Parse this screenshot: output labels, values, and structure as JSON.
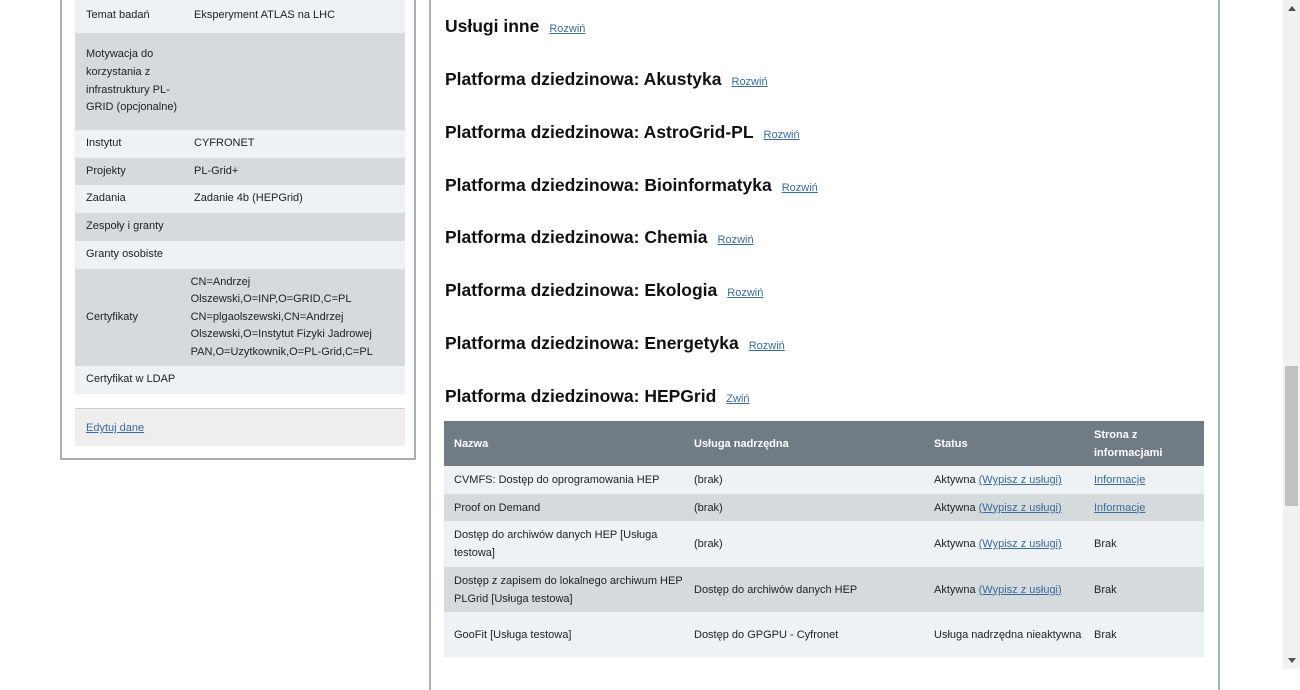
{
  "profile": {
    "rows": [
      {
        "key": "Temat badań",
        "value": "Eksperyment ATLAS na LHC"
      },
      {
        "key": "Motywacja do korzystania z infrastruktury PL-GRID (opcjonalne)",
        "value": ""
      },
      {
        "key": "Instytut",
        "value": "CYFRONET"
      },
      {
        "key": "Projekty",
        "value": "PL-Grid+"
      },
      {
        "key": "Zadania",
        "value": "Zadanie 4b (HEPGrid)"
      },
      {
        "key": "Zespoły i granty",
        "value": ""
      },
      {
        "key": "Granty osobiste",
        "value": ""
      },
      {
        "key": "Certyfikaty",
        "value": "CN=Andrzej Olszewski,O=INP,O=GRID,C=PL CN=plgaolszewski,CN=Andrzej Olszewski,O=Instytut Fizyki Jadrowej PAN,O=Uzytkownik,O=PL-Grid,C=PL"
      },
      {
        "key": "Certyfikat w LDAP",
        "value": ""
      }
    ],
    "edit_label": "Edytuj dane"
  },
  "sections": [
    {
      "title": "Usługi inne",
      "link": "Rozwiń"
    },
    {
      "title": "Platforma dziedzinowa: Akustyka",
      "link": "Rozwiń"
    },
    {
      "title": "Platforma dziedzinowa: AstroGrid-PL",
      "link": "Rozwiń"
    },
    {
      "title": "Platforma dziedzinowa: Bioinformatyka",
      "link": "Rozwiń"
    },
    {
      "title": "Platforma dziedzinowa: Chemia",
      "link": "Rozwiń"
    },
    {
      "title": "Platforma dziedzinowa: Ekologia",
      "link": "Rozwiń"
    },
    {
      "title": "Platforma dziedzinowa: Energetyka",
      "link": "Rozwiń"
    },
    {
      "title": "Platforma dziedzinowa: HEPGrid",
      "link": "Zwiń"
    }
  ],
  "services_table": {
    "headers": [
      "Nazwa",
      "Usługa nadrzędna",
      "Status",
      "Strona z informacjami"
    ],
    "rows": [
      {
        "name": "CVMFS: Dostęp do oprogramowania HEP",
        "parent": "(brak)",
        "status": "Aktywna",
        "action": "(Wypisz z usługi)",
        "info": "Informacje",
        "info_link": true
      },
      {
        "name": "Proof on Demand",
        "parent": "(brak)",
        "status": "Aktywna",
        "action": "(Wypisz z usługi)",
        "info": "Informacje",
        "info_link": true
      },
      {
        "name": "Dostęp do archiwów danych HEP [Usługa testowa]",
        "parent": "(brak)",
        "status": "Aktywna",
        "action": "(Wypisz z usługi)",
        "info": "Brak",
        "info_link": false
      },
      {
        "name": "Dostęp z zapisem do lokalnego archiwum HEP PLGrid [Usługa testowa]",
        "parent": "Dostęp do archiwów danych HEP",
        "status": "Aktywna",
        "action": "(Wypisz z usługi)",
        "info": "Brak",
        "info_link": false
      },
      {
        "name": "GooFit [Usługa testowa]",
        "parent": "Dostęp do GPGPU - Cyfronet",
        "status": "Usługa nadrzędna nieaktywna",
        "action": "",
        "info": "Brak",
        "info_link": false
      }
    ]
  },
  "colors": {
    "row_light": "#eef2f4",
    "row_dark": "#d5dadd",
    "table_header": "#717b83",
    "link": "#3a6b9a"
  }
}
